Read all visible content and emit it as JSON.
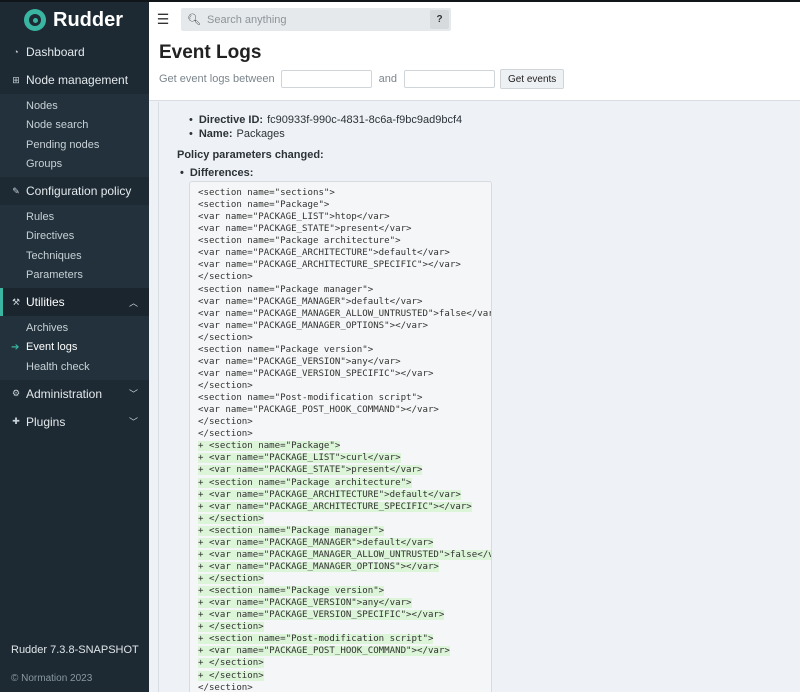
{
  "sidebar": {
    "brand": "Rudder",
    "items": [
      {
        "label": "Dashboard",
        "icon": "dashboard-icon"
      },
      {
        "label": "Node management",
        "icon": "sitemap-icon",
        "children": [
          "Nodes",
          "Node search",
          "Pending nodes",
          "Groups"
        ]
      },
      {
        "label": "Configuration policy",
        "icon": "pencil-icon",
        "children": [
          "Rules",
          "Directives",
          "Techniques",
          "Parameters"
        ]
      },
      {
        "label": "Utilities",
        "icon": "wrench-icon",
        "children": [
          "Archives",
          "Event logs",
          "Health check"
        ]
      },
      {
        "label": "Administration",
        "icon": "gear-icon"
      },
      {
        "label": "Plugins",
        "icon": "puzzle-icon"
      }
    ],
    "version": "Rudder 7.3.8-SNAPSHOT",
    "copyright": "© Normation 2023"
  },
  "topbar": {
    "search_placeholder": "Search anything",
    "help_label": "?"
  },
  "header": {
    "title": "Event Logs",
    "filter_label": "Get event logs between",
    "and_label": "and",
    "button": "Get events"
  },
  "details": {
    "directive_id_label": "Directive ID:",
    "directive_id": "fc90933f-990c-4831-8c6a-f9bc9ad9bcf4",
    "name_label": "Name:",
    "name": "Packages",
    "section_title": "Policy parameters changed:",
    "differences_label": "Differences:"
  },
  "diff_lines": [
    {
      "text": "<section name=\"sections\">",
      "added": false
    },
    {
      "text": "<section name=\"Package\">",
      "added": false
    },
    {
      "text": "<var name=\"PACKAGE_LIST\">htop</var>",
      "added": false
    },
    {
      "text": "<var name=\"PACKAGE_STATE\">present</var>",
      "added": false
    },
    {
      "text": "<section name=\"Package architecture\">",
      "added": false
    },
    {
      "text": "<var name=\"PACKAGE_ARCHITECTURE\">default</var>",
      "added": false
    },
    {
      "text": "<var name=\"PACKAGE_ARCHITECTURE_SPECIFIC\"></var>",
      "added": false
    },
    {
      "text": "</section>",
      "added": false
    },
    {
      "text": "<section name=\"Package manager\">",
      "added": false
    },
    {
      "text": "<var name=\"PACKAGE_MANAGER\">default</var>",
      "added": false
    },
    {
      "text": "<var name=\"PACKAGE_MANAGER_ALLOW_UNTRUSTED\">false</var>",
      "added": false
    },
    {
      "text": "<var name=\"PACKAGE_MANAGER_OPTIONS\"></var>",
      "added": false
    },
    {
      "text": "</section>",
      "added": false
    },
    {
      "text": "<section name=\"Package version\">",
      "added": false
    },
    {
      "text": "<var name=\"PACKAGE_VERSION\">any</var>",
      "added": false
    },
    {
      "text": "<var name=\"PACKAGE_VERSION_SPECIFIC\"></var>",
      "added": false
    },
    {
      "text": "</section>",
      "added": false
    },
    {
      "text": "<section name=\"Post-modification script\">",
      "added": false
    },
    {
      "text": "<var name=\"PACKAGE_POST_HOOK_COMMAND\"></var>",
      "added": false
    },
    {
      "text": "</section>",
      "added": false
    },
    {
      "text": "</section>",
      "added": false
    },
    {
      "text": "+ <section name=\"Package\">",
      "added": true
    },
    {
      "text": "+ <var name=\"PACKAGE_LIST\">curl</var>",
      "added": true
    },
    {
      "text": "+ <var name=\"PACKAGE_STATE\">present</var>",
      "added": true
    },
    {
      "text": "+ <section name=\"Package architecture\">",
      "added": true
    },
    {
      "text": "+ <var name=\"PACKAGE_ARCHITECTURE\">default</var>",
      "added": true
    },
    {
      "text": "+ <var name=\"PACKAGE_ARCHITECTURE_SPECIFIC\"></var>",
      "added": true
    },
    {
      "text": "+ </section>",
      "added": true
    },
    {
      "text": "+ <section name=\"Package manager\">",
      "added": true
    },
    {
      "text": "+ <var name=\"PACKAGE_MANAGER\">default</var>",
      "added": true
    },
    {
      "text": "+ <var name=\"PACKAGE_MANAGER_ALLOW_UNTRUSTED\">false</var>",
      "added": true
    },
    {
      "text": "+ <var name=\"PACKAGE_MANAGER_OPTIONS\"></var>",
      "added": true
    },
    {
      "text": "+ </section>",
      "added": true
    },
    {
      "text": "+ <section name=\"Package version\">",
      "added": true
    },
    {
      "text": "+ <var name=\"PACKAGE_VERSION\">any</var>",
      "added": true
    },
    {
      "text": "+ <var name=\"PACKAGE_VERSION_SPECIFIC\"></var>",
      "added": true
    },
    {
      "text": "+ </section>",
      "added": true
    },
    {
      "text": "+ <section name=\"Post-modification script\">",
      "added": true
    },
    {
      "text": "+ <var name=\"PACKAGE_POST_HOOK_COMMAND\"></var>",
      "added": true
    },
    {
      "text": "+ </section>",
      "added": true
    },
    {
      "text": "+ </section>",
      "added": true
    },
    {
      "text": "</section>",
      "added": false
    }
  ]
}
